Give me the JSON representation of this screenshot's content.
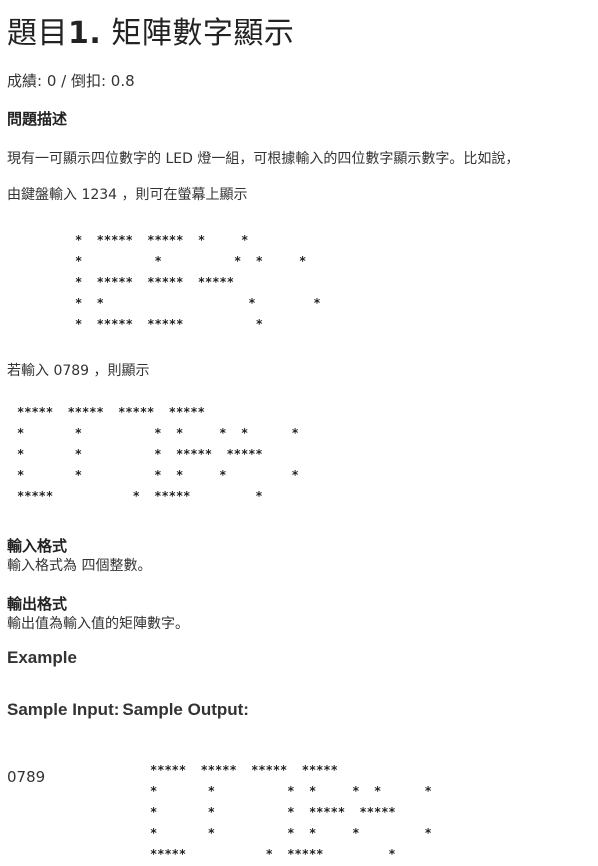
{
  "title": {
    "prefix": "題目",
    "number": "1.",
    "name": "矩陣數字顯示"
  },
  "score": "成績: 0 / 倒扣: 0.8",
  "sections": {
    "description_heading": "問題描述",
    "description_line1": "現有一可顯示四位數字的 LED 燈一組，可根據輸入的四位數字顯示數字。比如說，",
    "description_line2": "由鍵盤輸入 1234 ，則可在螢幕上顯示",
    "pattern_1234": "*  *****  *****  *     *\n*          *          *  *     *\n*  *****  *****  *****\n*  *                    *        *\n*  *****  *****          *",
    "if_input_text": "若輸入 0789 ，則顯示",
    "pattern_0789": "*****  *****  *****  *****\n*       *          *  *     *  *      *\n*       *          *  *****  *****\n*       *          *  *     *         *\n*****           *  *****         *",
    "input_format_heading": "輸入格式",
    "input_format_text": "輸入格式為 四個整數。",
    "output_format_heading": "輸出格式",
    "output_format_text": "輸出值為輸入值的矩陣數字。",
    "example_heading": "Example",
    "sample_input_header": "Sample Input:",
    "sample_output_header": "Sample Output:",
    "sample_input_value": "0789",
    "sample_output_pattern": "*****  *****  *****  *****\n*       *          *  *     *  *      *\n*       *          *  *****  *****\n*       *          *  *     *         *\n*****           *  *****         *"
  }
}
